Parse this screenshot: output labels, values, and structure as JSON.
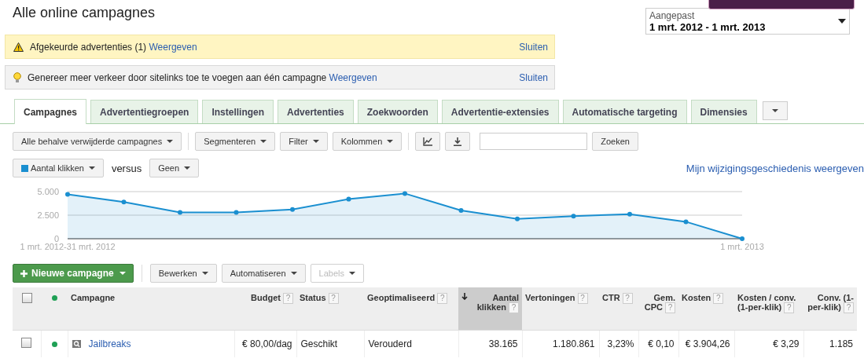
{
  "page": {
    "title": "Alle online campagnes"
  },
  "date_range": {
    "label": "Aangepast",
    "value": "1 mrt. 2012 - 1 mrt. 2013"
  },
  "alerts": [
    {
      "kind": "warning",
      "text": "Afgekeurde advertenties (1)",
      "link": "Weergeven",
      "close": "Sluiten"
    },
    {
      "kind": "tip",
      "text": "Genereer meer verkeer door sitelinks toe te voegen aan één campagne",
      "link": "Weergeven",
      "close": "Sluiten"
    }
  ],
  "tabs": [
    {
      "label": "Campagnes",
      "selected": true
    },
    {
      "label": "Advertentiegroepen",
      "selected": false
    },
    {
      "label": "Instellingen",
      "selected": false
    },
    {
      "label": "Advertenties",
      "selected": false
    },
    {
      "label": "Zoekwoorden",
      "selected": false
    },
    {
      "label": "Advertentie-extensies",
      "selected": false
    },
    {
      "label": "Automatische targeting",
      "selected": false
    },
    {
      "label": "Dimensies",
      "selected": false
    }
  ],
  "toolbar": {
    "dropdowns": [
      "Alle behalve verwijderde campagnes",
      "Segmenteren",
      "Filter",
      "Kolommen"
    ],
    "search_button": "Zoeken"
  },
  "metrics": {
    "metric": {
      "label": "Aantal klikken",
      "color": "#1a8fd0"
    },
    "versus": "versus",
    "compare": "Geen",
    "history_link": "Mijn wijzigingsgeschiedenis weergeven"
  },
  "chart": {
    "chart_data": {
      "type": "area",
      "categories": [
        "1 mrt. 2012-31 mrt. 2012",
        null,
        null,
        null,
        null,
        null,
        null,
        null,
        null,
        null,
        null,
        null,
        "1 mrt. 2013"
      ],
      "series": [
        {
          "color": "#1a8fd0",
          "values": [
            4700,
            3900,
            2800,
            2800,
            3100,
            4200,
            4800,
            3000,
            2100,
            2400,
            2600,
            1800,
            0
          ]
        }
      ],
      "yticks": [
        {
          "value": 0,
          "label": "0"
        },
        {
          "value": 2500,
          "label": "2.500"
        },
        {
          "value": 5000,
          "label": "5.000"
        }
      ],
      "ylim": [
        0,
        5000
      ]
    }
  },
  "actions": {
    "new_button": "Nieuwe campagne",
    "buttons": [
      {
        "label": "Bewerken",
        "disabled": false
      },
      {
        "label": "Automatiseren",
        "disabled": false
      },
      {
        "label": "Labels",
        "disabled": true
      }
    ]
  },
  "table": {
    "header_checked": false,
    "columns": [
      {
        "label": "Campagne",
        "sorted": false
      },
      {
        "label": "Budget",
        "help": "?",
        "sorted": false
      },
      {
        "label": "Status",
        "help": "?",
        "sorted": false
      },
      {
        "label": "Geoptimaliseerd",
        "help": "?",
        "sorted": false
      },
      {
        "label": "Aantal klikken",
        "help": "?",
        "sorted": true
      },
      {
        "label": "Vertoningen",
        "help": "?",
        "sorted": false
      },
      {
        "label": "CTR",
        "help": "?",
        "sorted": false
      },
      {
        "label": "Gem. CPC",
        "help": "?",
        "sorted": false
      },
      {
        "label": "Kosten",
        "help": "?",
        "sorted": false
      },
      {
        "label": "Kosten / conv. (1-per-klik)",
        "help": "?",
        "sorted": false
      },
      {
        "label": "Conv. (1-per-klik)",
        "help": "?",
        "sorted": false
      }
    ],
    "rows": [
      {
        "checked": false,
        "color": "#1fa055",
        "cells": [
          "Jailbreaks",
          "€ 80,00/dag",
          "Geschikt",
          "Verouderd",
          "38.165",
          "1.180.861",
          "3,23%",
          "€ 0,10",
          "€ 3.904,26",
          "€ 3,29",
          "1.185"
        ]
      }
    ]
  }
}
